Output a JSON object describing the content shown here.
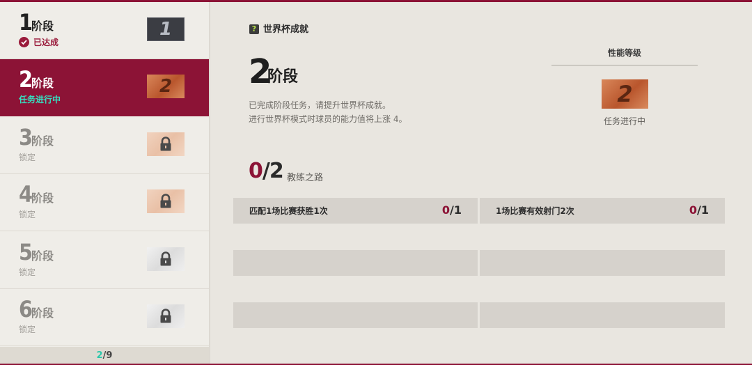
{
  "stages": [
    {
      "number": "1",
      "word": "阶段",
      "status": "已达成",
      "badge_digit": "1",
      "state": "done"
    },
    {
      "number": "2",
      "word": "阶段",
      "status": "任务进行中",
      "badge_digit": "2",
      "state": "active"
    },
    {
      "number": "3",
      "word": "阶段",
      "status": "锁定",
      "state": "locked"
    },
    {
      "number": "4",
      "word": "阶段",
      "status": "锁定",
      "state": "locked"
    },
    {
      "number": "5",
      "word": "阶段",
      "status": "锁定",
      "state": "locked"
    },
    {
      "number": "6",
      "word": "阶段",
      "status": "锁定",
      "state": "locked"
    }
  ],
  "pager": {
    "current": "2",
    "separator": "/",
    "total": "9"
  },
  "detail": {
    "category": "世界杯成就",
    "stage_number": "2",
    "stage_word": "阶段",
    "desc_line1": "已完成阶段任务，请提升世界杯成就。",
    "desc_line2": "进行世界杯模式时球员的能力值将上涨 4。",
    "performance_label": "性能等级",
    "performance_badge_digit": "2",
    "performance_status": "任务进行中",
    "progress_current": "0",
    "progress_separator": "/",
    "progress_total": "2",
    "path_title": "教练之路"
  },
  "tasks": [
    {
      "label": "匹配1场比赛获胜1次",
      "current": "0",
      "separator": "/",
      "total": "1"
    },
    {
      "label": "1场比赛有效射门2次",
      "current": "0",
      "separator": "/",
      "total": "1"
    }
  ],
  "colors": {
    "accent": "#8c1336",
    "teal": "#35e0c0",
    "background": "#e9e6e0"
  },
  "icons": {
    "check": "check-icon",
    "lock": "lock-icon",
    "question": "question-icon"
  }
}
